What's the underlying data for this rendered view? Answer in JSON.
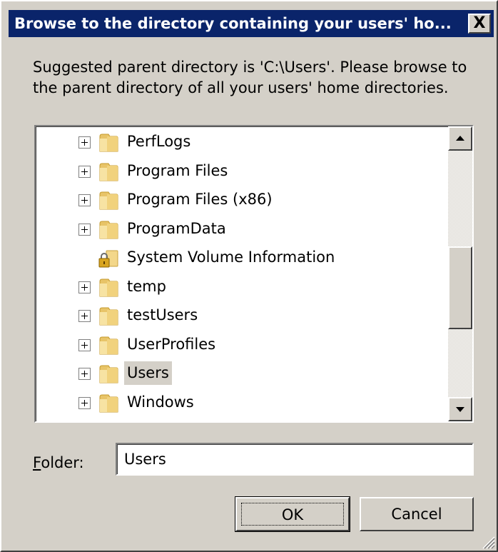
{
  "dialog": {
    "title": "Browse to the directory containing your users' ho...",
    "close_symbol": "X",
    "description": "Suggested parent directory is 'C:\\Users'. Please browse to the parent directory of all your users' home directories."
  },
  "tree": {
    "items": [
      {
        "label": "PerfLogs",
        "icon": "folder-icon",
        "expandable": true
      },
      {
        "label": "Program Files",
        "icon": "folder-icon",
        "expandable": true
      },
      {
        "label": "Program Files (x86)",
        "icon": "folder-icon",
        "expandable": true
      },
      {
        "label": "ProgramData",
        "icon": "folder-icon",
        "expandable": true
      },
      {
        "label": "System Volume Information",
        "icon": "locked-folder-icon",
        "expandable": false
      },
      {
        "label": "temp",
        "icon": "folder-icon",
        "expandable": true
      },
      {
        "label": "testUsers",
        "icon": "folder-icon",
        "expandable": true
      },
      {
        "label": "UserProfiles",
        "icon": "folder-icon",
        "expandable": true
      },
      {
        "label": "Users",
        "icon": "folder-icon",
        "expandable": true,
        "selected": true
      },
      {
        "label": "Windows",
        "icon": "folder-icon",
        "expandable": true
      }
    ]
  },
  "folder": {
    "label_accel": "F",
    "label_rest": "older:",
    "value": "Users"
  },
  "buttons": {
    "ok": "OK",
    "cancel": "Cancel"
  },
  "colors": {
    "title_bar": "#0a246a",
    "face": "#d4d0c8",
    "selection": "#d4d0c8"
  }
}
